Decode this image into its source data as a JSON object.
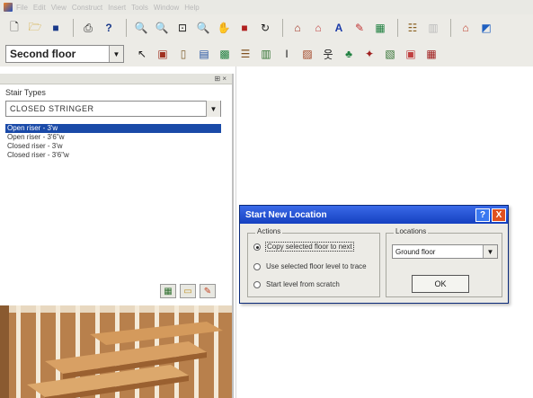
{
  "menu": {
    "items": [
      "File",
      "Edit",
      "View",
      "Construct",
      "Insert",
      "Tools",
      "Window",
      "Help"
    ]
  },
  "toolbar": {
    "floor_value": "Second floor"
  },
  "stair_panel": {
    "label": "Stair Types",
    "type_value": "CLOSED STRINGER",
    "items": [
      {
        "label": "Open riser - 3'w",
        "selected": true
      },
      {
        "label": "Open riser - 3'6\"w",
        "selected": false
      },
      {
        "label": "Closed riser - 3'w",
        "selected": false
      },
      {
        "label": "Closed riser - 3'6\"w",
        "selected": false
      }
    ]
  },
  "dialog": {
    "title": "Start New Location",
    "help_label": "?",
    "close_label": "X",
    "actions_legend": "Actions",
    "options": [
      {
        "label": "Copy selected floor to next",
        "selected": true
      },
      {
        "label": "Use selected floor level to trace",
        "selected": false
      },
      {
        "label": "Start level from scratch",
        "selected": false
      }
    ],
    "locations_legend": "Locations",
    "location_value": "Ground floor",
    "ok_label": "OK"
  },
  "colors": {
    "title_bar": "#1540c0",
    "selection": "#1a4aa8",
    "close": "#e05020",
    "stair_wood": "#c98a52"
  }
}
